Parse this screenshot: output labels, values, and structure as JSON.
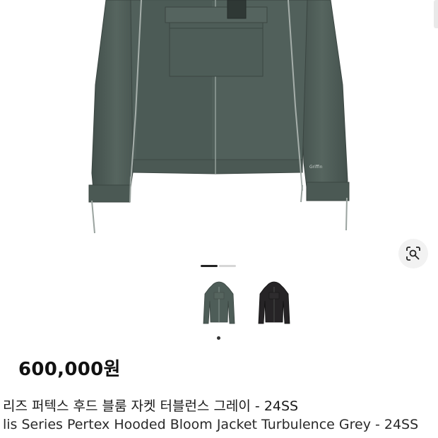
{
  "product": {
    "price": "600,000원",
    "title_ko": "리즈 퍼텍스 후드 블룸 자켓 터블런스 그레이 - 24SS",
    "title_en": "lis Series Pertex Hooded Bloom Jacket Turbulence Grey - 24SS",
    "jacket_brand_mark": "Griffin"
  },
  "gallery": {
    "slide_count": 2,
    "active_slide": 1,
    "thumbnails": [
      {
        "name": "grey-jacket",
        "color": "#4e5d58",
        "selected": true
      },
      {
        "name": "black-jacket",
        "color": "#262426",
        "selected": false
      }
    ]
  },
  "icons": {
    "lens": "lens-search-icon"
  },
  "colors": {
    "jacket": "#4f5e59",
    "indicator_active": "#222222",
    "indicator_inactive": "#d6d6d6"
  }
}
